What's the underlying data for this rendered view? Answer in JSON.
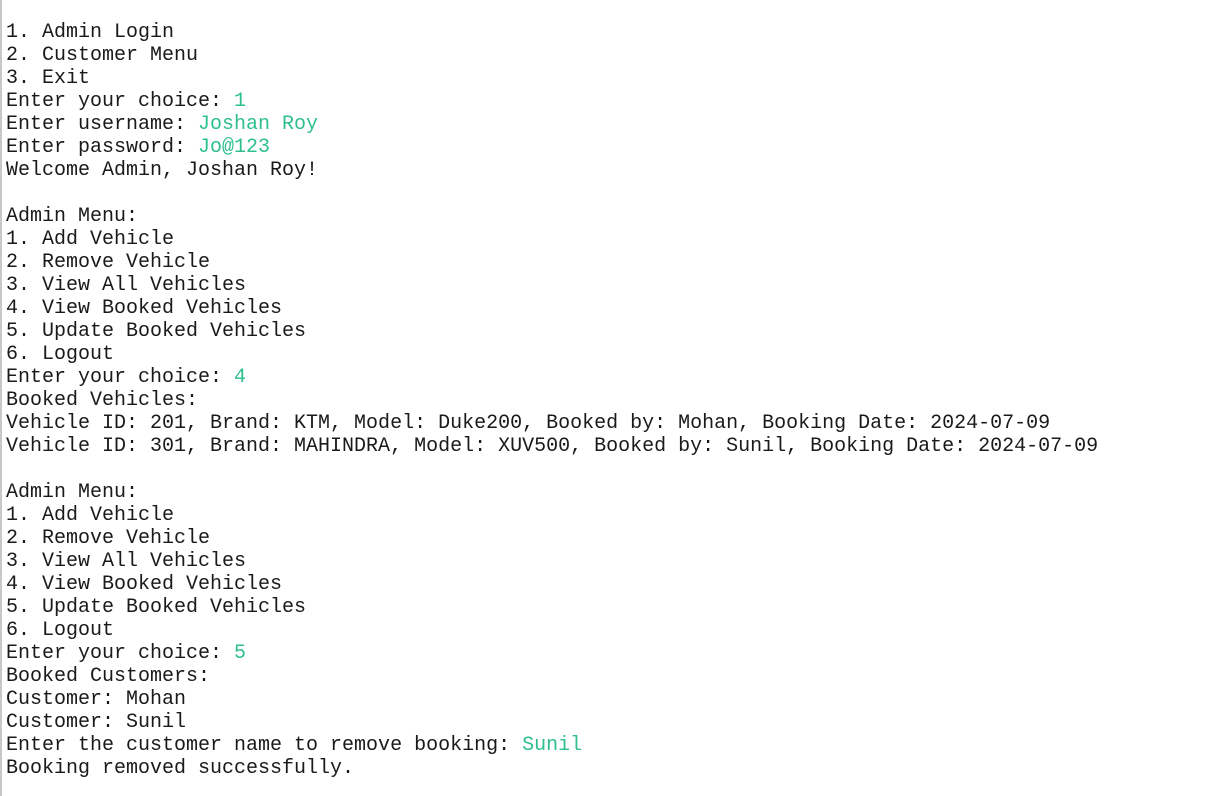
{
  "colors": {
    "text": "#1a1a1a",
    "user_input": "#2ebf8c",
    "background": "#ffffff"
  },
  "console_lines": [
    {
      "text": "1. Admin Login",
      "input": ""
    },
    {
      "text": "2. Customer Menu",
      "input": ""
    },
    {
      "text": "3. Exit",
      "input": ""
    },
    {
      "text": "Enter your choice: ",
      "input": "1"
    },
    {
      "text": "Enter username: ",
      "input": "Joshan Roy"
    },
    {
      "text": "Enter password: ",
      "input": "Jo@123"
    },
    {
      "text": "Welcome Admin, Joshan Roy!",
      "input": ""
    },
    {
      "text": "",
      "input": ""
    },
    {
      "text": "Admin Menu:",
      "input": ""
    },
    {
      "text": "1. Add Vehicle",
      "input": ""
    },
    {
      "text": "2. Remove Vehicle",
      "input": ""
    },
    {
      "text": "3. View All Vehicles",
      "input": ""
    },
    {
      "text": "4. View Booked Vehicles",
      "input": ""
    },
    {
      "text": "5. Update Booked Vehicles",
      "input": ""
    },
    {
      "text": "6. Logout",
      "input": ""
    },
    {
      "text": "Enter your choice: ",
      "input": "4"
    },
    {
      "text": "Booked Vehicles:",
      "input": ""
    },
    {
      "text": "Vehicle ID: 201, Brand: KTM, Model: Duke200, Booked by: Mohan, Booking Date: 2024-07-09",
      "input": ""
    },
    {
      "text": "Vehicle ID: 301, Brand: MAHINDRA, Model: XUV500, Booked by: Sunil, Booking Date: 2024-07-09",
      "input": ""
    },
    {
      "text": "",
      "input": ""
    },
    {
      "text": "Admin Menu:",
      "input": ""
    },
    {
      "text": "1. Add Vehicle",
      "input": ""
    },
    {
      "text": "2. Remove Vehicle",
      "input": ""
    },
    {
      "text": "3. View All Vehicles",
      "input": ""
    },
    {
      "text": "4. View Booked Vehicles",
      "input": ""
    },
    {
      "text": "5. Update Booked Vehicles",
      "input": ""
    },
    {
      "text": "6. Logout",
      "input": ""
    },
    {
      "text": "Enter your choice: ",
      "input": "5"
    },
    {
      "text": "Booked Customers:",
      "input": ""
    },
    {
      "text": "Customer: Mohan",
      "input": ""
    },
    {
      "text": "Customer: Sunil",
      "input": ""
    },
    {
      "text": "Enter the customer name to remove booking: ",
      "input": "Sunil"
    },
    {
      "text": "Booking removed successfully.",
      "input": ""
    }
  ]
}
